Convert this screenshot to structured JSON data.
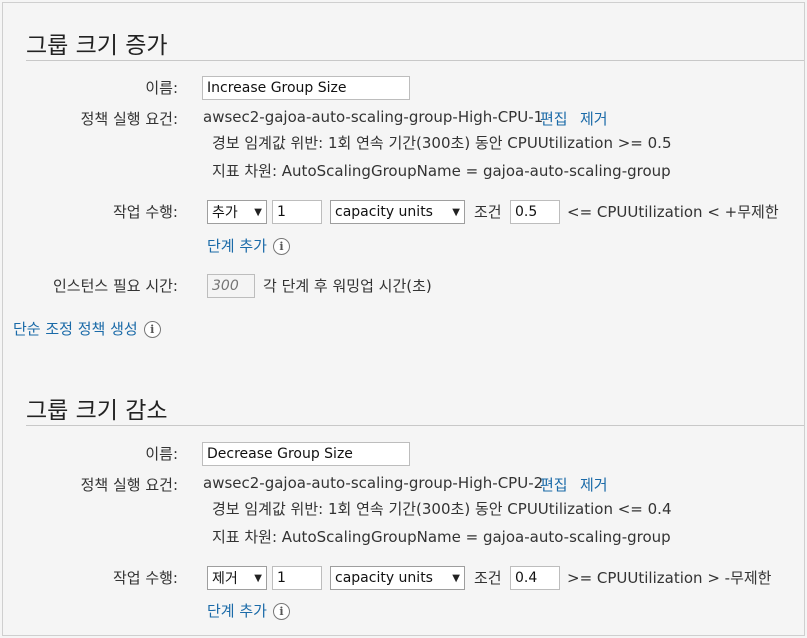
{
  "increase": {
    "title": "그룹 크기 증가",
    "name_label": "이름:",
    "name_value": "Increase Group Size",
    "policy_label": "정책 실행 요건:",
    "alarm_name": "awsec2-gajoa-auto-scaling-group-High-CPU-1",
    "edit_link": "편집",
    "remove_link": "제거",
    "alarm_breach": "경보 임계값 위반: 1회 연속 기간(300초) 동안 CPUUtilization >= 0.5",
    "alarm_dimension": "지표 차원: AutoScalingGroupName = gajoa-auto-scaling-group",
    "action_label": "작업 수행:",
    "action_select": "추가",
    "quantity": "1",
    "unit_select": "capacity units",
    "condition_label": "조건",
    "condition_value": "0.5",
    "condition_text": "<= CPUUtilization < +무제한",
    "add_step_link": "단계 추가",
    "warmup_label": "인스턴스 필요 시간:",
    "warmup_placeholder": "300",
    "warmup_suffix": "각 단계 후 워밍업 시간(초)",
    "simple_policy_link": "단순 조정 정책 생성"
  },
  "decrease": {
    "title": "그룹 크기 감소",
    "name_label": "이름:",
    "name_value": "Decrease Group Size",
    "policy_label": "정책 실행 요건:",
    "alarm_name": "awsec2-gajoa-auto-scaling-group-High-CPU-2",
    "edit_link": "편집",
    "remove_link": "제거",
    "alarm_breach": "경보 임계값 위반: 1회 연속 기간(300초) 동안 CPUUtilization <= 0.4",
    "alarm_dimension": "지표 차원: AutoScalingGroupName = gajoa-auto-scaling-group",
    "action_label": "작업 수행:",
    "action_select": "제거",
    "quantity": "1",
    "unit_select": "capacity units",
    "condition_label": "조건",
    "condition_value": "0.4",
    "condition_text": ">= CPUUtilization > -무제한",
    "add_step_link": "단계 추가"
  },
  "icons": {
    "caret": "▼",
    "info": "i"
  },
  "colors": {
    "link": "#1a6aa8",
    "background": "#f5f5f5"
  }
}
